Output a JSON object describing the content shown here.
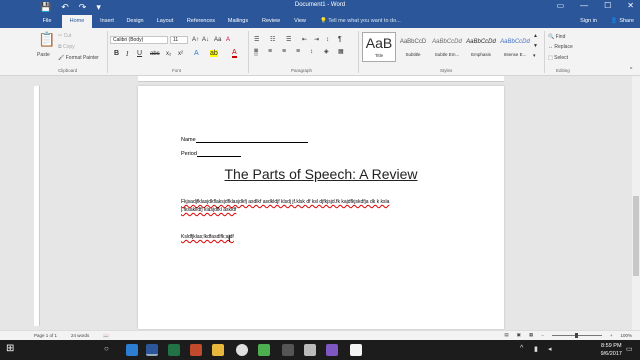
{
  "titlebar": {
    "title": "Document1 - Word",
    "qat": {
      "save": "💾",
      "undo": "↶",
      "redo": "↷",
      "customize": "▾"
    },
    "controls": {
      "ribbon_options": "▭",
      "minimize": "—",
      "maximize": "☐",
      "close": "✕"
    }
  },
  "tabs": [
    {
      "label": "File"
    },
    {
      "label": "Home"
    },
    {
      "label": "Insert"
    },
    {
      "label": "Design"
    },
    {
      "label": "Layout"
    },
    {
      "label": "References"
    },
    {
      "label": "Mailings"
    },
    {
      "label": "Review"
    },
    {
      "label": "View"
    }
  ],
  "tell_me": "Tell me what you want to do...",
  "account": {
    "sign_in": "Sign in",
    "share": "Share"
  },
  "ribbon": {
    "clipboard": {
      "paste": "Paste",
      "cut": "Cut",
      "copy": "Copy",
      "format_painter": "Format Painter",
      "label": "Clipboard"
    },
    "font": {
      "name": "Calibri (Body)",
      "size": "11",
      "label": "Font"
    },
    "paragraph": {
      "label": "Paragraph"
    },
    "styles": {
      "label": "Styles",
      "items": [
        {
          "preview": "AaB",
          "name": "Title"
        },
        {
          "preview": "AaBbCcD",
          "name": "Subtitle"
        },
        {
          "preview": "AaBbCcDd",
          "name": "Subtle Em..."
        },
        {
          "preview": "AaBbCcDd",
          "name": "Emphasis"
        },
        {
          "preview": "AaBbCcDd",
          "name": "Intense E..."
        }
      ]
    },
    "editing": {
      "find": "Find",
      "replace": "Replace",
      "select": "Select",
      "label": "Editing"
    }
  },
  "document": {
    "name_label": "Name",
    "period_label": "Period",
    "title": "The Parts of Speech: A Review",
    "para1_line1": "Fkjsadjfklasjdkflaksjdfklasjdkfj asdlkf asdkldjf klsdj jf.klsk df ksl djfkjsjd.fk kajdfkjskdfja dk k ksla",
    "para1_line2": "j.fksaklldfj klasjdfkl askldf",
    "para2": "Ksldfjklas;lkdfasdlfk;ajdf"
  },
  "status": {
    "page": "Page 1 of 1",
    "words": "24 words",
    "zoom": "100%"
  },
  "taskbar": {
    "start": "⊞",
    "time": "8:59 PM",
    "date": "9/6/2017"
  }
}
